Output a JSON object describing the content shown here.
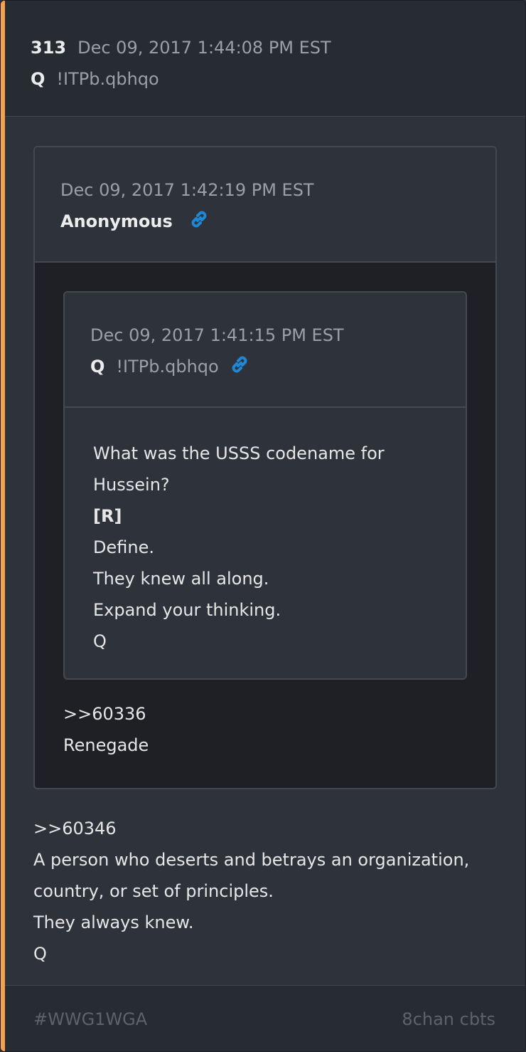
{
  "post": {
    "number": "313",
    "timestamp": "Dec 09, 2017 1:44:08 PM EST",
    "author": "Q",
    "tripcode": "!ITPb.qbhqo",
    "text_lines": [
      ">>60346",
      "A person who deserts and betrays an organization,",
      "country, or set of principles.",
      "They always knew.",
      "Q"
    ]
  },
  "quote_outer": {
    "timestamp": "Dec 09, 2017 1:42:19 PM EST",
    "author": "Anonymous",
    "text_lines": [
      ">>60336",
      "Renegade"
    ]
  },
  "quote_inner": {
    "timestamp": "Dec 09, 2017 1:41:15 PM EST",
    "author": "Q",
    "tripcode": "!ITPb.qbhqo",
    "text_lines": [
      "What was the USSS codename for",
      "Hussein?",
      "[R]",
      "Define.",
      "They knew all along.",
      "Expand your thinking.",
      "Q"
    ]
  },
  "footer": {
    "hashtag": "#WWG1WGA",
    "source": "8chan cbts"
  },
  "colors": {
    "accent": "#f5a04c",
    "link_icon": "#1e88d6",
    "background": "#2e333b"
  },
  "icons": {
    "link": "link-icon"
  }
}
